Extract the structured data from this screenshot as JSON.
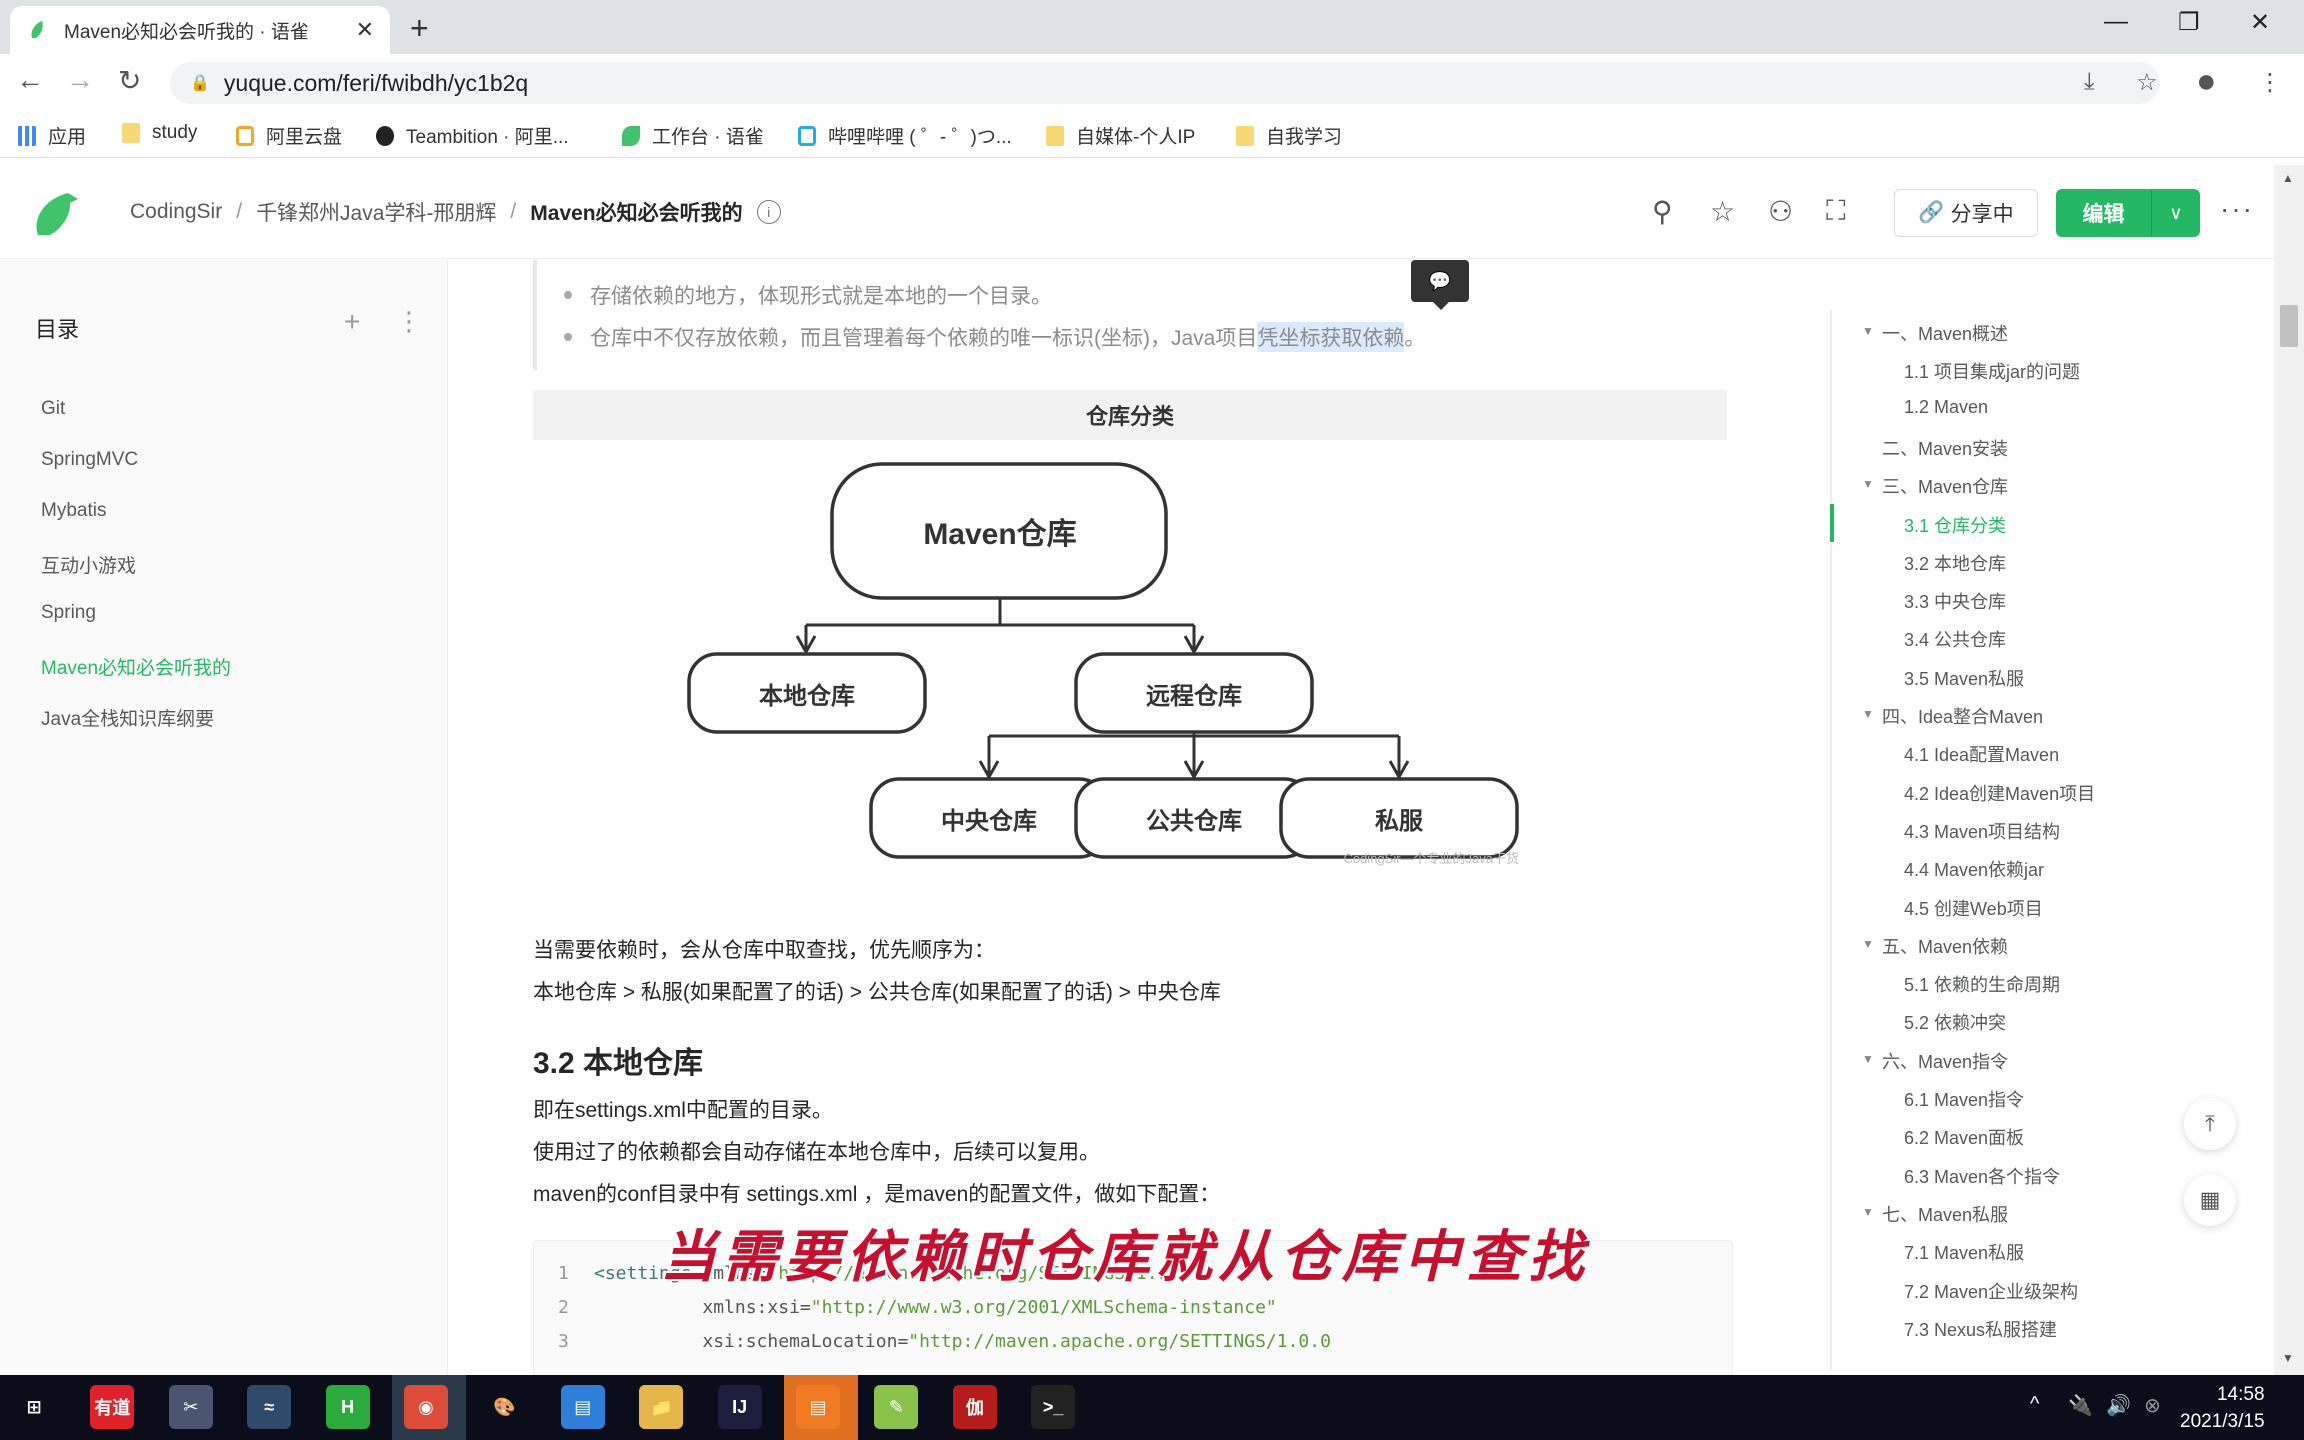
{
  "browser": {
    "tab_title": "Maven必知必会听我的 · 语雀",
    "tab_close": "✕",
    "new_tab": "+",
    "url": "yuque.com/feri/fwibdh/yc1b2q",
    "bookmarks": [
      {
        "label": "应用",
        "icon": "apps-grid-icon"
      },
      {
        "label": "study",
        "icon": "folder-icon"
      },
      {
        "label": "阿里云盘",
        "icon": "aliyun-drive-icon"
      },
      {
        "label": "Teambition · 阿里...",
        "icon": "teambition-icon"
      },
      {
        "label": "工作台 · 语雀",
        "icon": "yuque-icon"
      },
      {
        "label": "哔哩哔哩 ( ゜- ゜)つ...",
        "icon": "bilibili-icon"
      },
      {
        "label": "自媒体-个人IP",
        "icon": "folder-icon"
      },
      {
        "label": "自我学习",
        "icon": "folder-icon"
      }
    ]
  },
  "header": {
    "breadcrumb": [
      "CodingSir",
      "千锋郑州Java学科-邢朋辉",
      "Maven必知必会听我的"
    ],
    "share_label": "分享中",
    "edit_label": "编辑",
    "brand_color": "#25b864"
  },
  "sidebar": {
    "title": "目录",
    "items": [
      {
        "label": "Git",
        "active": false
      },
      {
        "label": "SpringMVC",
        "active": false
      },
      {
        "label": "Mybatis",
        "active": false
      },
      {
        "label": "互动小游戏",
        "active": false
      },
      {
        "label": "Spring",
        "active": false
      },
      {
        "label": "Maven必知必会听我的",
        "active": true
      },
      {
        "label": "Java全栈知识库纲要",
        "active": false
      }
    ]
  },
  "content": {
    "bullets": [
      "存储依赖的地方，体现形式就是本地的一个目录。",
      {
        "before": "仓库中不仅存放依赖，而且管理着每个依赖的唯一标识(坐标)，Java项目",
        "highlight": "凭坐标获取依赖",
        "after": "。"
      }
    ],
    "table_header": "仓库分类",
    "diagram": {
      "root": "Maven仓库",
      "level1": [
        "本地仓库",
        "远程仓库"
      ],
      "level2": [
        "中央仓库",
        "公共仓库",
        "私服"
      ],
      "watermark": "CodingSir—个专业的Java干货"
    },
    "para1": "当需要依赖时，会从仓库中取查找，优先顺序为：",
    "para2": "本地仓库 > 私服(如果配置了的话) > 公共仓库(如果配置了的话) > 中央仓库",
    "heading": "3.2 本地仓库",
    "para3": "即在settings.xml中配置的目录。",
    "para4": "使用过了的依赖都会自动存储在本地仓库中，后续可以复用。",
    "para5": "maven的conf目录中有 settings.xml ，是maven的配置文件，做如下配置：",
    "code_lines": [
      {
        "n": "1",
        "tag": "<settings ",
        "attr": "xmlns=",
        "val": "\"http://maven.apache.org/SETTINGS/1.0.0\""
      },
      {
        "n": "2",
        "tag": "          ",
        "attr": "xmlns:xsi=",
        "val": "\"http://www.w3.org/2001/XMLSchema-instance\""
      },
      {
        "n": "3",
        "tag": "          ",
        "attr": "xsi:schemaLocation=",
        "val": "\"http://maven.apache.org/SETTINGS/1.0.0"
      }
    ],
    "subtitle": "当需要依赖时仓库就从仓库中查找"
  },
  "toc": {
    "items": [
      {
        "label": "一、Maven概述",
        "level": 1,
        "arrow": true
      },
      {
        "label": "1.1 项目集成jar的问题",
        "level": 2
      },
      {
        "label": "1.2 Maven",
        "level": 2
      },
      {
        "label": "二、Maven安装",
        "level": 1,
        "arrow": false
      },
      {
        "label": "三、Maven仓库",
        "level": 1,
        "arrow": true
      },
      {
        "label": "3.1 仓库分类",
        "level": 2,
        "active": true
      },
      {
        "label": "3.2 本地仓库",
        "level": 2
      },
      {
        "label": "3.3 中央仓库",
        "level": 2
      },
      {
        "label": "3.4 公共仓库",
        "level": 2
      },
      {
        "label": "3.5 Maven私服",
        "level": 2
      },
      {
        "label": "四、Idea整合Maven",
        "level": 1,
        "arrow": true
      },
      {
        "label": "4.1 Idea配置Maven",
        "level": 2
      },
      {
        "label": "4.2 Idea创建Maven项目",
        "level": 2
      },
      {
        "label": "4.3 Maven项目结构",
        "level": 2
      },
      {
        "label": "4.4 Maven依赖jar",
        "level": 2
      },
      {
        "label": "4.5 创建Web项目",
        "level": 2
      },
      {
        "label": "五、Maven依赖",
        "level": 1,
        "arrow": true
      },
      {
        "label": "5.1 依赖的生命周期",
        "level": 2
      },
      {
        "label": "5.2 依赖冲突",
        "level": 2
      },
      {
        "label": "六、Maven指令",
        "level": 1,
        "arrow": true
      },
      {
        "label": "6.1 Maven指令",
        "level": 2
      },
      {
        "label": "6.2 Maven面板",
        "level": 2
      },
      {
        "label": "6.3 Maven各个指令",
        "level": 2
      },
      {
        "label": "七、Maven私服",
        "level": 1,
        "arrow": true
      },
      {
        "label": "7.1 Maven私服",
        "level": 2
      },
      {
        "label": "7.2 Maven企业级架构",
        "level": 2
      },
      {
        "label": "7.3 Nexus私服搭建",
        "level": 2
      }
    ]
  },
  "taskbar": {
    "apps": [
      {
        "name": "start",
        "label": "⊞",
        "color": "#0b0e1a"
      },
      {
        "name": "youdao",
        "label": "有道",
        "color": "#e0202a"
      },
      {
        "name": "snipping",
        "label": "✂",
        "color": "#4a5570"
      },
      {
        "name": "mysql-workbench",
        "label": "≈",
        "color": "#2f4a6a"
      },
      {
        "name": "hbuilder",
        "label": "H",
        "color": "#2bab3b"
      },
      {
        "name": "chrome",
        "label": "◉",
        "color": "#dd4b39"
      },
      {
        "name": "paint",
        "label": "🎨",
        "color": "#0b0e1a"
      },
      {
        "name": "notepad",
        "label": "▤",
        "color": "#2d7fd8"
      },
      {
        "name": "explorer",
        "label": "📁",
        "color": "#e6b648"
      },
      {
        "name": "intellij",
        "label": "IJ",
        "color": "#1d1d3d"
      },
      {
        "name": "app-orange",
        "label": "▤",
        "color": "#f07b23"
      },
      {
        "name": "notepad-plus",
        "label": "✎",
        "color": "#8bc34a"
      },
      {
        "name": "app-red",
        "label": "伽",
        "color": "#b71c1c"
      },
      {
        "name": "terminal",
        "label": ">_",
        "color": "#222"
      }
    ],
    "time": "14:58",
    "date": "2021/3/15"
  }
}
